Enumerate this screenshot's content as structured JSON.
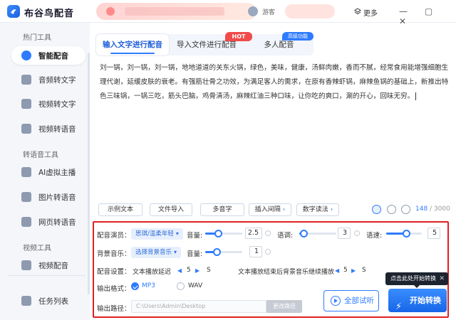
{
  "app": {
    "title": "布谷鸟配音",
    "user_name": "游客",
    "more_label": "更多",
    "window_controls": "— ▢ ✕"
  },
  "sidebar": {
    "section_hot": "热门工具",
    "section_voice": "转语音工具",
    "section_video": "视频工具",
    "items": [
      {
        "label": "智能配音",
        "icon": "mic-icon",
        "active": true
      },
      {
        "label": "音频转文字",
        "icon": "audio-to-text-icon"
      },
      {
        "label": "视频转文字",
        "icon": "video-to-text-icon"
      },
      {
        "label": "视频转语音",
        "icon": "video-to-voice-icon"
      },
      {
        "label": "AI虚拟主播",
        "icon": "ai-host-icon"
      },
      {
        "label": "图片转语音",
        "icon": "image-to-voice-icon"
      },
      {
        "label": "网页转语音",
        "icon": "web-to-voice-icon"
      },
      {
        "label": "视频配音",
        "icon": "video-dub-icon"
      },
      {
        "label": "任务列表",
        "icon": "task-list-icon"
      }
    ]
  },
  "tabs": [
    {
      "label": "输入文字进行配音",
      "active": true
    },
    {
      "label": "导入文件进行配音",
      "badge": "HOT"
    },
    {
      "label": "多人配音",
      "badge": "高级功能"
    }
  ],
  "editor": {
    "text": "刘一锅，刘一锅，刘一锅，地地道道的关东火锅，绿色，美味，健康，汤鲜肉嫩，香而不腻，经常食用能增强细胞生理代谢，延缓皮肤的衰老。有强筋壮骨之功效，为满足客人的需求，在原有香辣虾锅，麻辣鱼锅的基础上，新推出特色三味锅，一锅三吃，筋头巴脑，鸡骨清汤，麻辣红油三种口味，让你吃的爽口，涮的开心，回味无穷。"
  },
  "toolbar": {
    "sample": "示例文本",
    "import": "文件导入",
    "polyphone": "多音字",
    "pause": "插入间隔",
    "digit": "数字读法",
    "char_count": "148",
    "char_max": "/ 3000"
  },
  "settings": {
    "voice_label": "配音演员：",
    "voice_value": "思琪/温柔年轻",
    "volume_label": "音量:",
    "volume_value": "2.5",
    "volume_level": 0.35,
    "pitch_label": "语调:",
    "pitch_value": "3",
    "pitch_level": 0.12,
    "speed_label": "语速:",
    "speed_value": "5",
    "speed_level": 0.55,
    "bgm_label": "背景音乐：",
    "bgm_value": "选择背景音乐",
    "bgm_volume_label": "音量:",
    "bgm_volume_value": "1",
    "bgm_volume_level": 0.3,
    "config_label": "配音设置：",
    "delay_label": "文本播放延迟",
    "delay_value": "5",
    "delay_unit": "S",
    "bgm_continue_label": "文本播放结束后背景音乐继续播放",
    "bgm_continue_value": "5",
    "bgm_continue_unit": "S",
    "format_label": "输出格式：",
    "format_mp3": "MP3",
    "format_wav": "WAV",
    "path_label": "输出路径：",
    "path_value": "C:\\Users\\Admin\\Desktop",
    "change_path": "更改路径"
  },
  "actions": {
    "listen": "全部试听",
    "convert": "开始转换",
    "tooltip": "点击此处开始转换"
  },
  "colors": {
    "accent": "#2f7bff",
    "highlight_border": "#e02020",
    "hot_badge": "#f04a4a"
  }
}
